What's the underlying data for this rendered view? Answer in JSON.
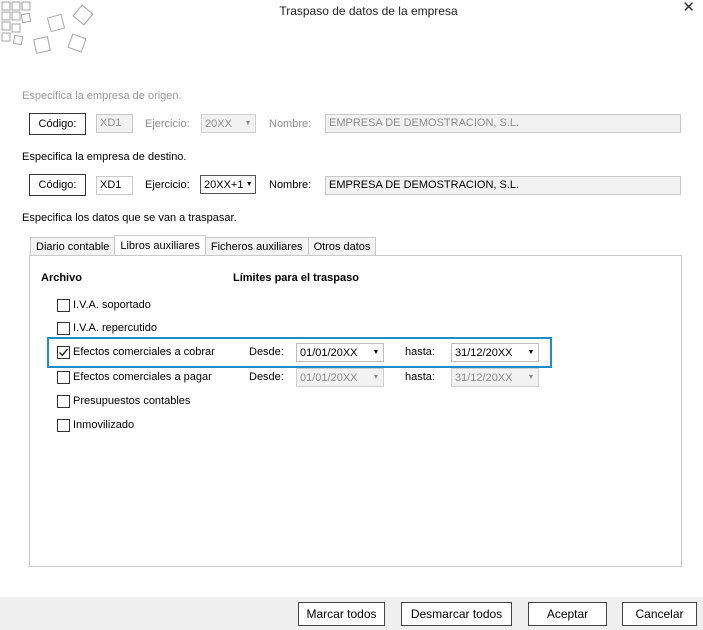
{
  "window": {
    "title": "Traspaso de datos de la empresa",
    "close_icon": "close-icon"
  },
  "origin": {
    "heading": "Especifica la empresa de origen.",
    "code_button": "Código:",
    "code_value": "XD1",
    "ejercicio_label": "Ejercicio:",
    "ejercicio_value": "20XX",
    "nombre_label": "Nombre:",
    "nombre_value": "EMPRESA DE DEMOSTRACION, S.L."
  },
  "destination": {
    "heading": "Especifica la empresa de destino.",
    "code_button": "Código:",
    "code_value": "XD1",
    "ejercicio_label": "Ejercicio:",
    "ejercicio_value": "20XX+1",
    "nombre_label": "Nombre:",
    "nombre_value": "EMPRESA DE DEMOSTRACION, S.L."
  },
  "data_section": {
    "heading": "Especifica los datos que se van a traspasar."
  },
  "tabs": [
    {
      "label": "Diario contable",
      "active": false
    },
    {
      "label": "Libros auxiliares",
      "active": true
    },
    {
      "label": "Ficheros auxiliares",
      "active": false
    },
    {
      "label": "Otros datos",
      "active": false
    }
  ],
  "panel": {
    "archivo_header": "Archivo",
    "limites_header": "Límites para el traspaso",
    "rows": [
      {
        "label": "I.V.A. soportado",
        "checked": false
      },
      {
        "label": "I.V.A. repercutido",
        "checked": false
      },
      {
        "label": "Efectos comerciales a cobrar",
        "checked": true,
        "desde_label": "Desde:",
        "desde": "01/01/20XX",
        "hasta_label": "hasta:",
        "hasta": "31/12/20XX",
        "enabled": true
      },
      {
        "label": "Efectos comerciales a pagar",
        "checked": false,
        "desde_label": "Desde:",
        "desde": "01/01/20XX",
        "hasta_label": "hasta:",
        "hasta": "31/12/20XX",
        "enabled": false
      },
      {
        "label": "Presupuestos contables",
        "checked": false
      },
      {
        "label": "Inmovilizado",
        "checked": false
      }
    ]
  },
  "footer": {
    "mark_all": "Marcar todos",
    "unmark_all": "Desmarcar todos",
    "accept": "Aceptar",
    "cancel": "Cancelar"
  },
  "colors": {
    "highlight": "#1f8bc7",
    "footer_bg": "#f0f0f0"
  }
}
